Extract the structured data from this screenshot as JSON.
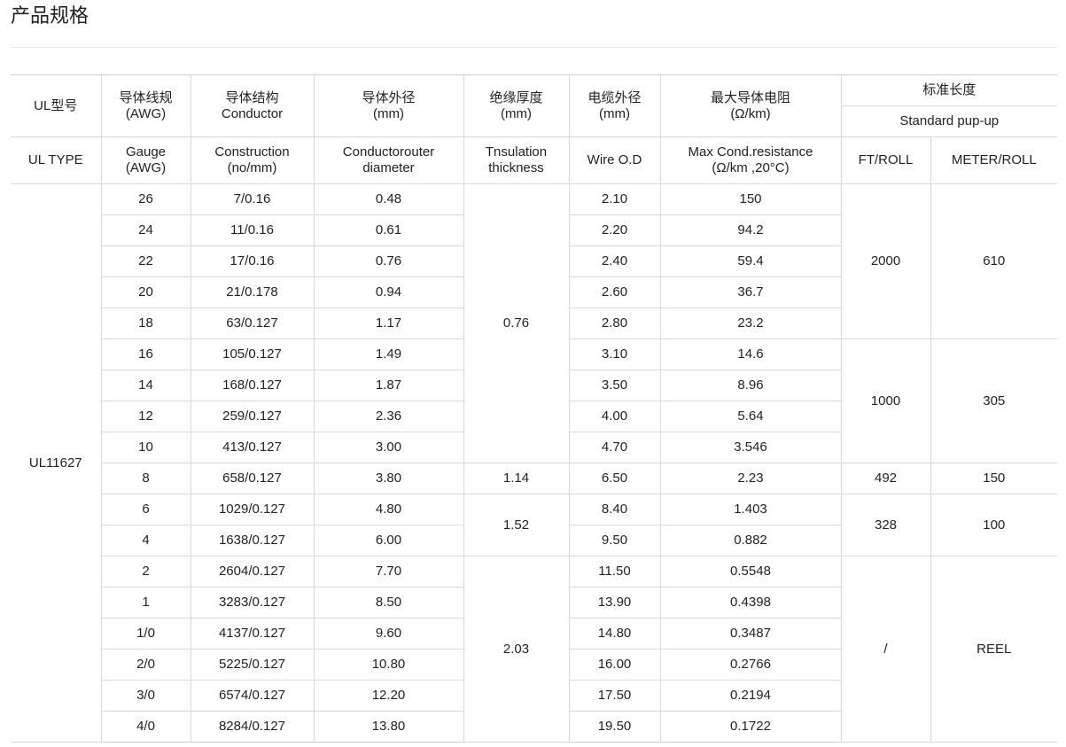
{
  "page": {
    "title": "产品规格"
  },
  "header": {
    "ul_model_cn": "UL型号",
    "gauge_cn": "导体线规",
    "gauge_cn_unit": "(AWG)",
    "structure_cn": "导体结构",
    "structure_en": "Conductor",
    "cond_od_cn": "导体外径",
    "cond_od_unit": "(mm)",
    "insulation_cn": "绝缘厚度",
    "insulation_unit": "(mm)",
    "cable_od_cn": "电缆外径",
    "cable_od_unit": "(mm)",
    "max_res_cn": "最大导体电阻",
    "max_res_unit": "(Ω/km)",
    "std_length_cn": "标准长度",
    "std_length_en": "Standard pup-up",
    "ul_type": "UL TYPE",
    "gauge_en": "Gauge",
    "gauge_en_unit": "(AWG)",
    "construction_en": "Construction",
    "construction_unit": "(no/mm)",
    "cond_outer_en": "Conductorouter",
    "cond_outer_en2": "diameter",
    "insulation_en": "Tnsulation",
    "insulation_en2": "thickness",
    "wire_od_en": "Wire O.D",
    "max_res_en": "Max Cond.resistance",
    "max_res_en_unit": "(Ω/km ,20°C)",
    "ft_roll": "FT/ROLL",
    "meter_roll": "METER/ROLL"
  },
  "ul_type_value": "UL11627",
  "rows": [
    {
      "gauge": "26",
      "construction": "7/0.16",
      "cond_od": "0.48",
      "wire_od": "2.10",
      "resistance": "150"
    },
    {
      "gauge": "24",
      "construction": "11/0.16",
      "cond_od": "0.61",
      "wire_od": "2.20",
      "resistance": "94.2"
    },
    {
      "gauge": "22",
      "construction": "17/0.16",
      "cond_od": "0.76",
      "wire_od": "2.40",
      "resistance": "59.4"
    },
    {
      "gauge": "20",
      "construction": "21/0.178",
      "cond_od": "0.94",
      "wire_od": "2.60",
      "resistance": "36.7"
    },
    {
      "gauge": "18",
      "construction": "63/0.127",
      "cond_od": "1.17",
      "wire_od": "2.80",
      "resistance": "23.2"
    },
    {
      "gauge": "16",
      "construction": "105/0.127",
      "cond_od": "1.49",
      "wire_od": "3.10",
      "resistance": "14.6"
    },
    {
      "gauge": "14",
      "construction": "168/0.127",
      "cond_od": "1.87",
      "wire_od": "3.50",
      "resistance": "8.96"
    },
    {
      "gauge": "12",
      "construction": "259/0.127",
      "cond_od": "2.36",
      "wire_od": "4.00",
      "resistance": "5.64"
    },
    {
      "gauge": "10",
      "construction": "413/0.127",
      "cond_od": "3.00",
      "wire_od": "4.70",
      "resistance": "3.546"
    },
    {
      "gauge": "8",
      "construction": "658/0.127",
      "cond_od": "3.80",
      "wire_od": "6.50",
      "resistance": "2.23"
    },
    {
      "gauge": "6",
      "construction": "1029/0.127",
      "cond_od": "4.80",
      "wire_od": "8.40",
      "resistance": "1.403"
    },
    {
      "gauge": "4",
      "construction": "1638/0.127",
      "cond_od": "6.00",
      "wire_od": "9.50",
      "resistance": "0.882"
    },
    {
      "gauge": "2",
      "construction": "2604/0.127",
      "cond_od": "7.70",
      "wire_od": "11.50",
      "resistance": "0.5548"
    },
    {
      "gauge": "1",
      "construction": "3283/0.127",
      "cond_od": "8.50",
      "wire_od": "13.90",
      "resistance": "0.4398"
    },
    {
      "gauge": "1/0",
      "construction": "4137/0.127",
      "cond_od": "9.60",
      "wire_od": "14.80",
      "resistance": "0.3487"
    },
    {
      "gauge": "2/0",
      "construction": "5225/0.127",
      "cond_od": "10.80",
      "wire_od": "16.00",
      "resistance": "0.2766"
    },
    {
      "gauge": "3/0",
      "construction": "6574/0.127",
      "cond_od": "12.20",
      "wire_od": "17.50",
      "resistance": "0.2194"
    },
    {
      "gauge": "4/0",
      "construction": "8284/0.127",
      "cond_od": "13.80",
      "wire_od": "19.50",
      "resistance": "0.1722"
    }
  ],
  "insulation_groups": [
    "0.76",
    "1.14",
    "1.52",
    "2.03"
  ],
  "length_groups": [
    {
      "ft": "2000",
      "meter": "610"
    },
    {
      "ft": "1000",
      "meter": "305"
    },
    {
      "ft": "492",
      "meter": "150"
    },
    {
      "ft": "328",
      "meter": "100"
    },
    {
      "ft": "/",
      "meter": "REEL"
    }
  ]
}
